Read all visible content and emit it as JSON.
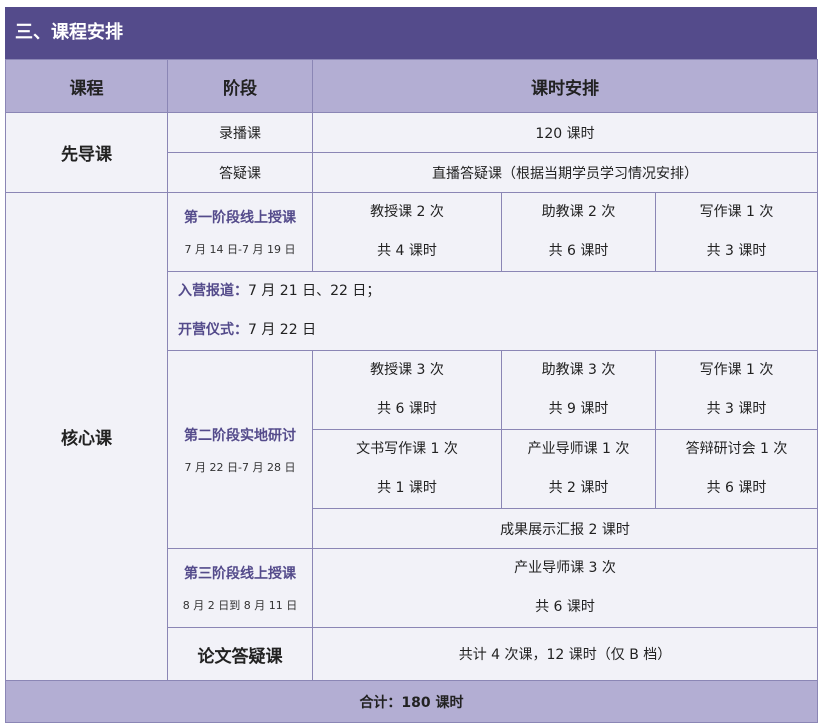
{
  "section_title": "三、课程安排",
  "headers": {
    "course": "课程",
    "stage": "阶段",
    "schedule": "课时安排"
  },
  "pre": {
    "course": "先导课",
    "rows": [
      {
        "stage": "录播课",
        "value": "120 课时"
      },
      {
        "stage": "答疑课",
        "value": "直播答疑课（根据当期学员学习情况安排）"
      }
    ]
  },
  "core": {
    "course": "核心课",
    "phase1": {
      "name": "第一阶段线上授课",
      "date": "7 月 14 日-7 月 19 日",
      "cells": [
        {
          "line1": "教授课 2 次",
          "line2": "共 4 课时"
        },
        {
          "line1": "助教课 2 次",
          "line2": "共 6 课时"
        },
        {
          "line1": "写作课 1 次",
          "line2": "共 3 课时"
        }
      ]
    },
    "camp": {
      "report_label": "入营报道：",
      "report_value": "7 月 21 日、22 日；",
      "open_label": "开营仪式：",
      "open_value": "7 月 22 日"
    },
    "phase2": {
      "name": "第二阶段实地研讨",
      "date": "7 月 22 日-7 月 28 日",
      "row1": [
        {
          "line1": "教授课 3 次",
          "line2": "共 6 课时"
        },
        {
          "line1": "助教课 3 次",
          "line2": "共 9 课时"
        },
        {
          "line1": "写作课 1 次",
          "line2": "共 3 课时"
        }
      ],
      "row2": [
        {
          "line1": "文书写作课 1 次",
          "line2": "共 1 课时"
        },
        {
          "line1": "产业导师课 1 次",
          "line2": "共 2 课时"
        },
        {
          "line1": "答辩研讨会 1 次",
          "line2": "共 6 课时"
        }
      ],
      "showcase": "成果展示汇报 2 课时"
    },
    "phase3": {
      "name": "第三阶段线上授课",
      "date": "8 月 2 日到 8 月 11 日",
      "line1": "产业导师课 3 次",
      "line2": "共 6 课时"
    }
  },
  "thesis": {
    "course": "论文答疑课",
    "value": "共计 4 次课，12 课时（仅 B 档）"
  },
  "total": "合计：180 课时"
}
